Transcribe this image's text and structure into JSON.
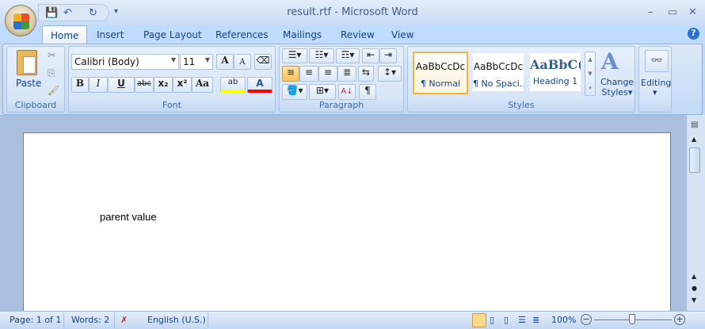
{
  "window": {
    "title": "result.rtf - Microsoft Word",
    "minimize": "–",
    "maximize": "▭",
    "close": "✕"
  },
  "qat": {
    "save": "💾",
    "undo": "↶",
    "redo": "↻",
    "more": "▾"
  },
  "tabs": [
    "Home",
    "Insert",
    "Page Layout",
    "References",
    "Mailings",
    "Review",
    "View"
  ],
  "help": "?",
  "clipboard": {
    "paste": "Paste",
    "label": "Clipboard"
  },
  "font": {
    "name": "Calibri (Body)",
    "size": "11",
    "grow": "A",
    "shrink": "A",
    "bold": "B",
    "italic": "I",
    "underline": "U",
    "strike": "abc",
    "sub": "x₂",
    "sup": "x²",
    "case": "Aa",
    "highlight": "ab",
    "color": "A",
    "label": "Font"
  },
  "paragraph": {
    "label": "Paragraph",
    "sort": "A↓",
    "pilcrow": "¶"
  },
  "styles": {
    "label": "Styles",
    "items": [
      {
        "preview": "AaBbCcDc",
        "name": "¶ Normal"
      },
      {
        "preview": "AaBbCcDc",
        "name": "¶ No Spaci..."
      },
      {
        "preview": "AaBbC(",
        "name": "Heading 1"
      }
    ],
    "change_line1": "Change",
    "change_line2": "Styles"
  },
  "editing": {
    "label": "Editing"
  },
  "document": {
    "text": "parent value"
  },
  "status": {
    "page": "Page: 1 of 1",
    "words": "Words: 2",
    "language": "English (U.S.)",
    "zoom": "100%",
    "zoom_percent": 100
  },
  "colors": {
    "highlight": "#ffff00",
    "font_color": "#ff0000",
    "accent": "#15428b"
  }
}
